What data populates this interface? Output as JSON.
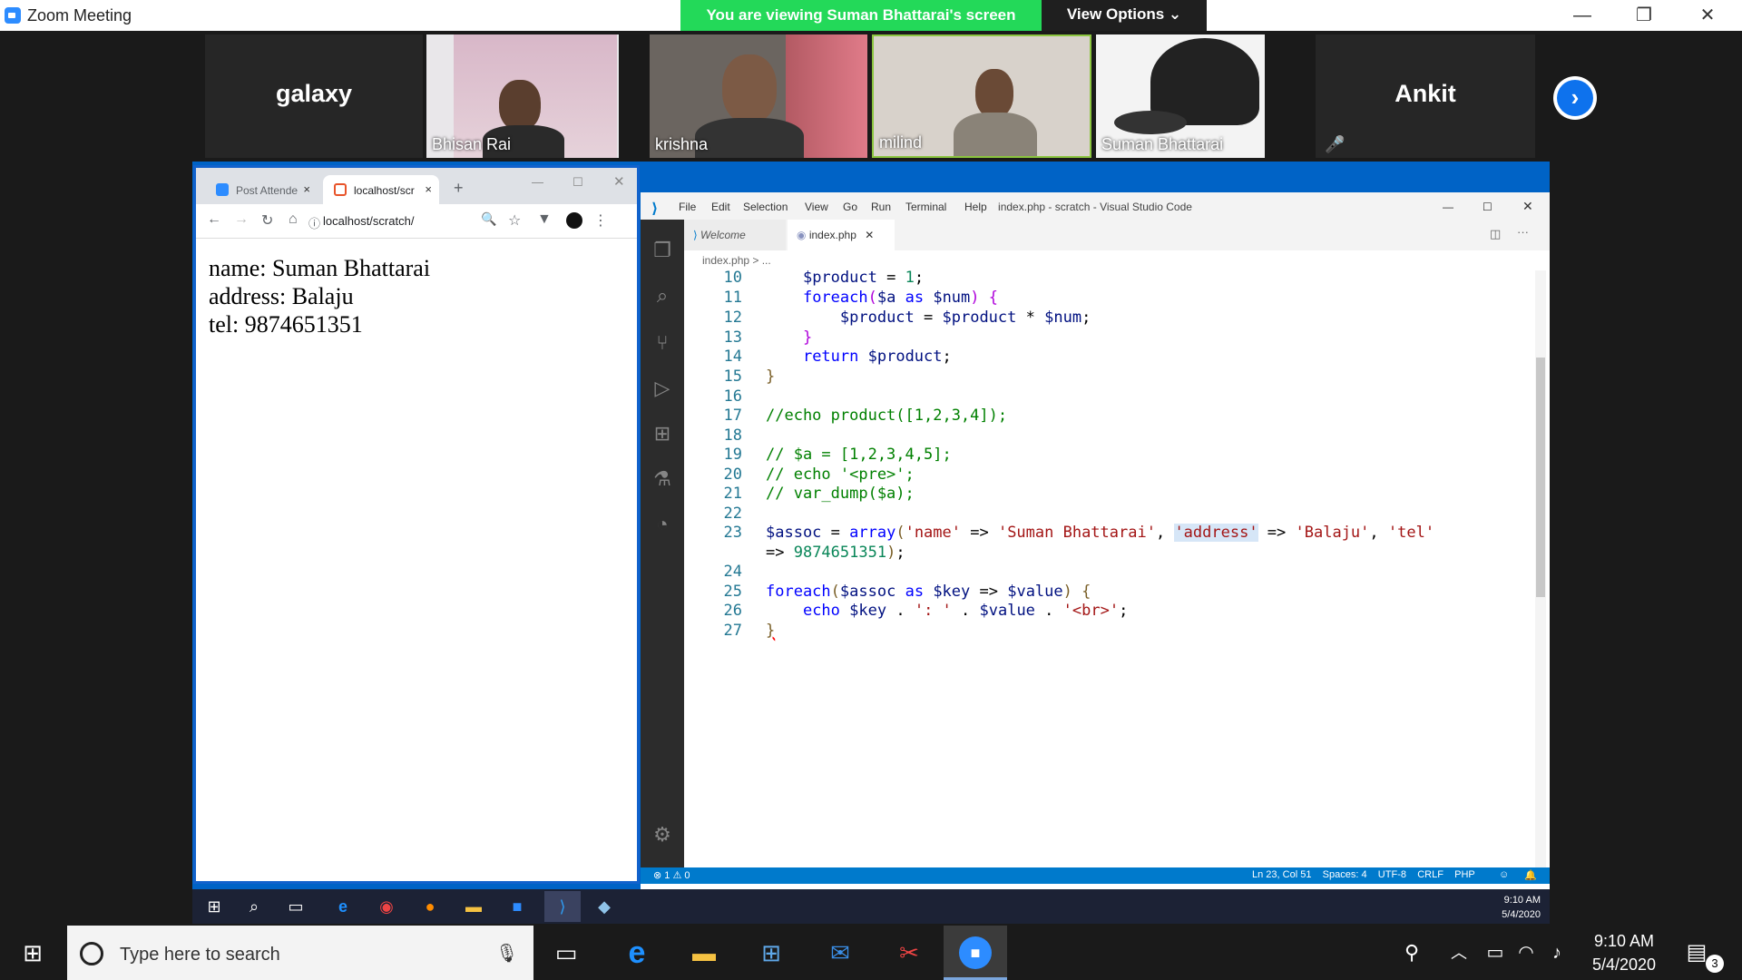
{
  "zoom": {
    "title": "Zoom Meeting",
    "viewing_banner": "You are viewing Suman Bhattarai's screen",
    "view_options": "View Options ⌄",
    "minimize": "—",
    "restore": "❐",
    "close": "✕"
  },
  "participants": [
    {
      "name": "galaxy"
    },
    {
      "name": "Bhisan Rai"
    },
    {
      "name": "krishna"
    },
    {
      "name": "milind"
    },
    {
      "name": "Suman Bhattarai"
    },
    {
      "name": "Ankit"
    }
  ],
  "next_arrow": "›",
  "chrome": {
    "tab1": "Post Attende",
    "tab2": "localhost/scr",
    "new_tab": "+",
    "tab_close": "×",
    "url": "localhost/scratch/",
    "page_lines": [
      "name: Suman Bhattarai",
      "address: Balaju",
      "tel: 9874651351"
    ]
  },
  "vscode": {
    "menu": [
      "File",
      "Edit",
      "Selection",
      "View",
      "Go",
      "Run",
      "Terminal",
      "Help"
    ],
    "window_title": "index.php - scratch - Visual Studio Code",
    "tabs": [
      "Welcome",
      "index.php"
    ],
    "breadcrumb": "index.php > ...",
    "line_numbers": [
      "10",
      "11",
      "12",
      "13",
      "14",
      "15",
      "16",
      "17",
      "18",
      "19",
      "20",
      "21",
      "22",
      "23",
      "",
      "24",
      "25",
      "26",
      "27"
    ],
    "status_left": "⊗ 1 ⚠ 0",
    "status_right": "Ln 23, Col 51    Spaces: 4    UTF-8    CRLF    PHP"
  },
  "inner_clock": {
    "time": "9:10 AM",
    "date": "5/4/2020"
  },
  "taskbar": {
    "search_placeholder": "Type here to search",
    "time": "9:10 AM",
    "date": "5/4/2020",
    "notifications": "3"
  }
}
